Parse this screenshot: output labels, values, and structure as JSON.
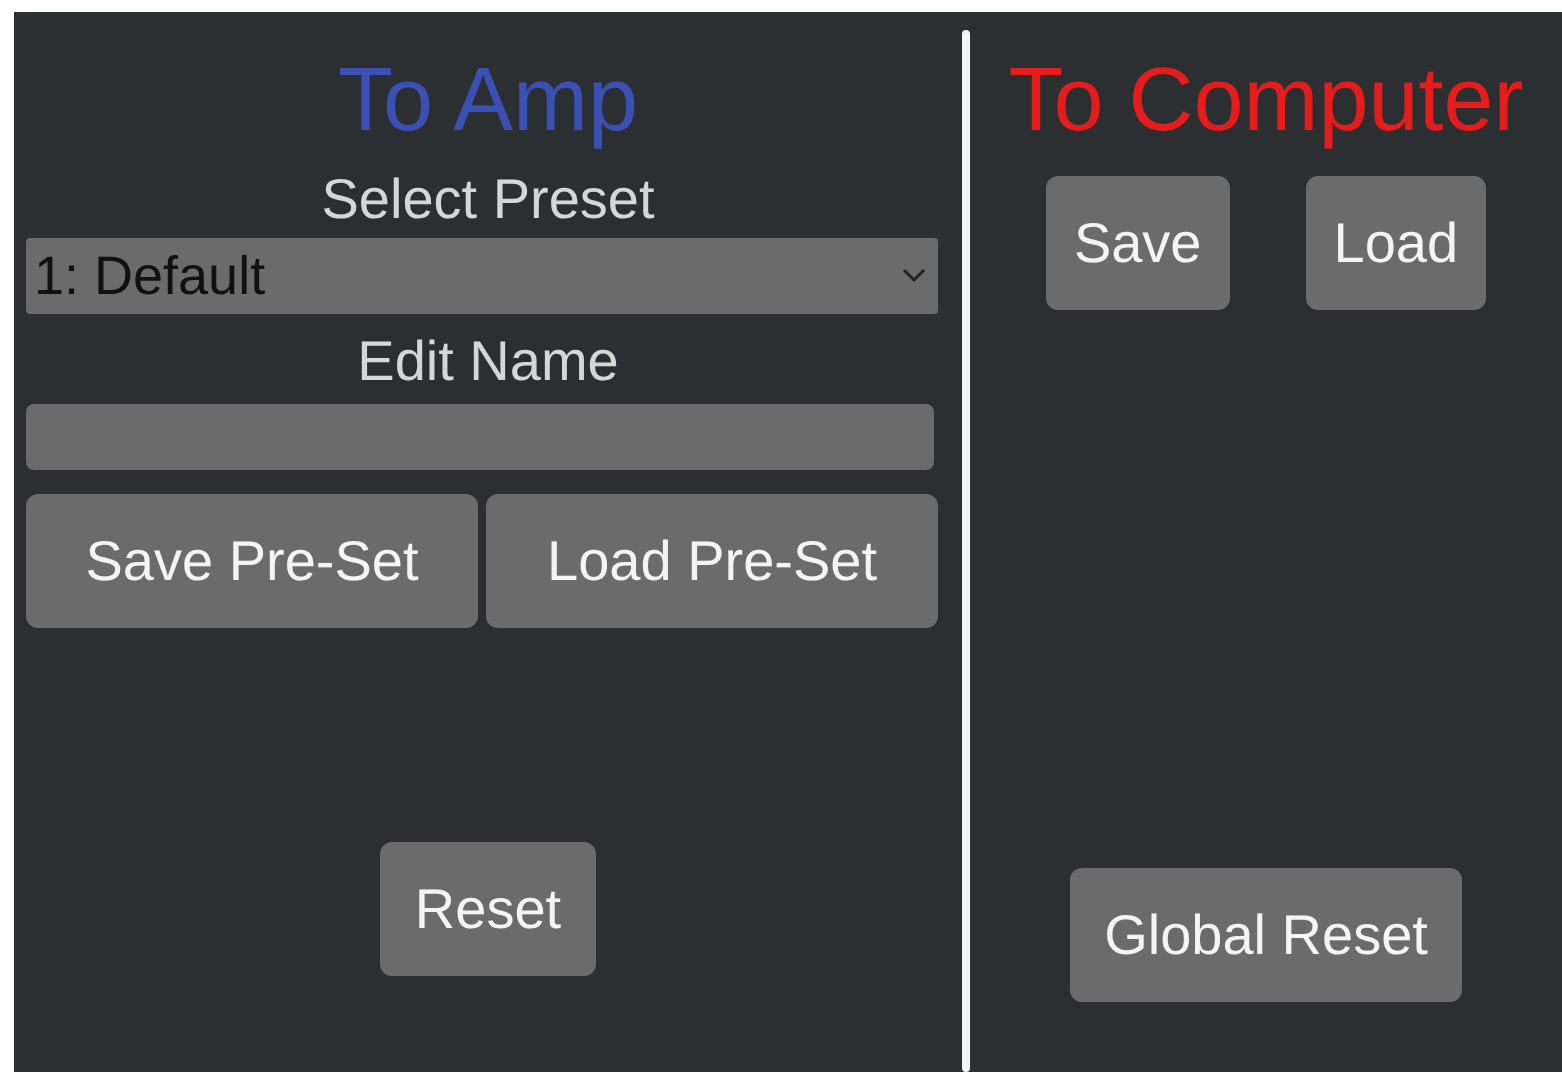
{
  "to_amp": {
    "title": "To Amp",
    "select_label": "Select Preset",
    "preset": {
      "value": "1: Default"
    },
    "name_label": "Edit Name",
    "buttons": [
      "Save Pre-Set",
      "Load Pre-Set"
    ],
    "reset": "Reset"
  },
  "to_computer": {
    "title": "To Computer",
    "buttons": [
      "Save",
      "Load"
    ],
    "reset": "Global Reset"
  }
}
